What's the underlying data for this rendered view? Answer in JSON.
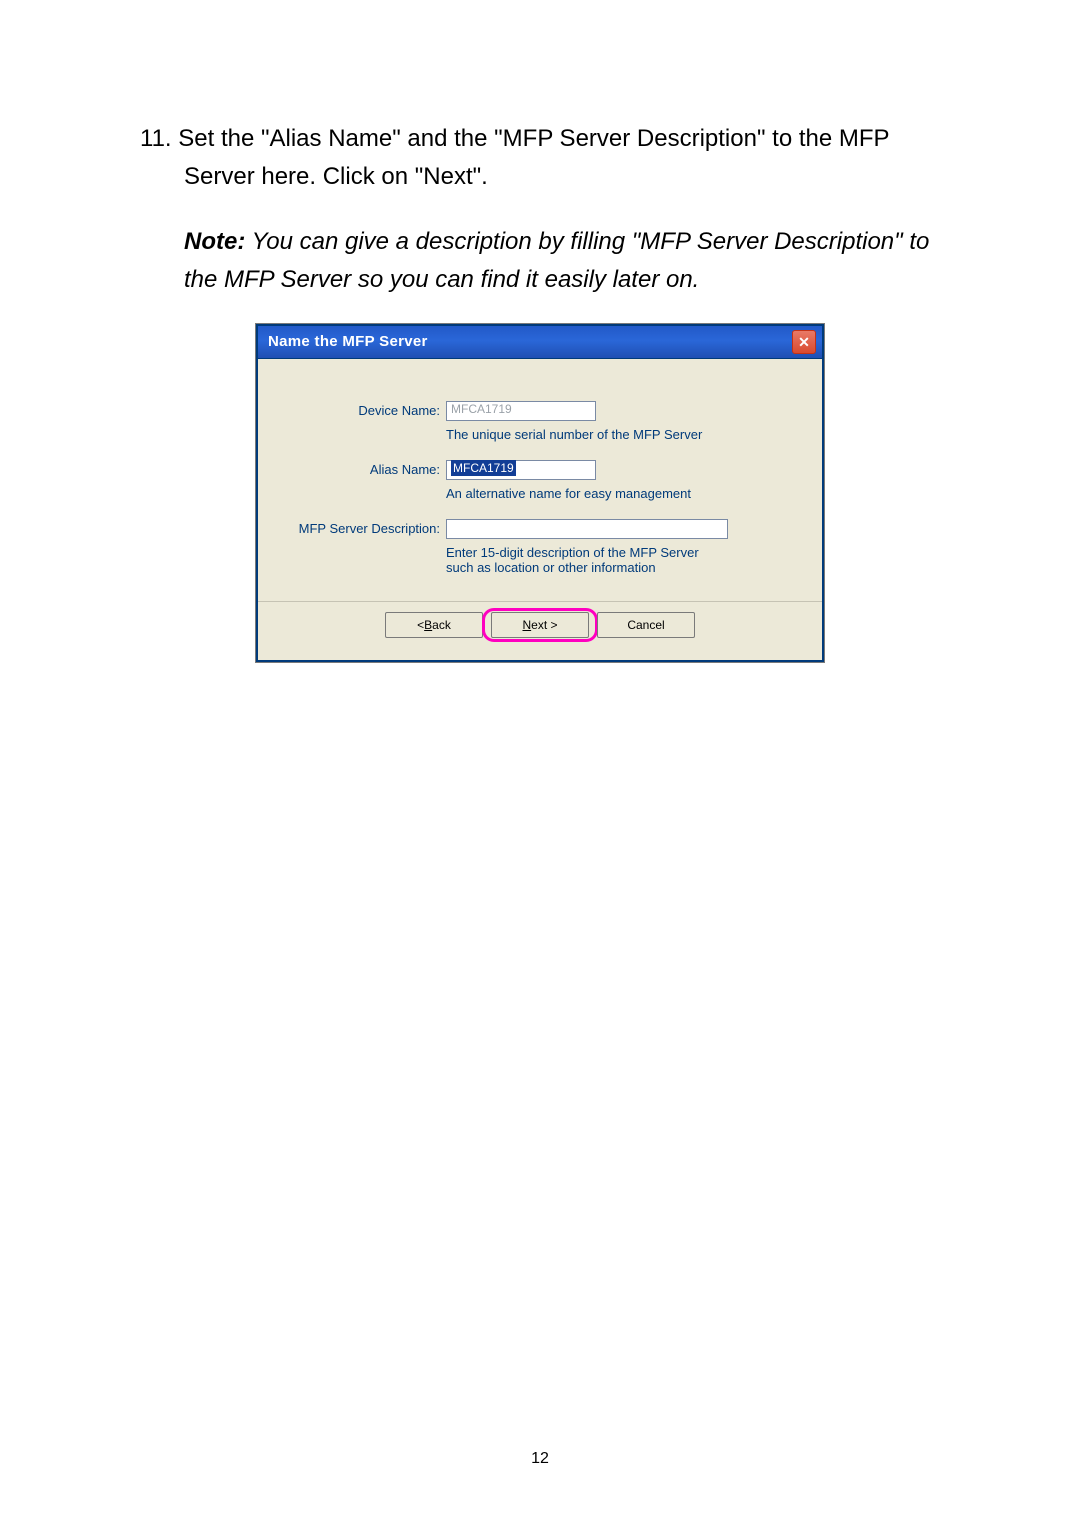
{
  "instruction": {
    "number": "11.",
    "text": "Set the \"Alias Name\" and the \"MFP Server Description\" to the MFP Server here. Click on \"Next\"."
  },
  "note": {
    "label": "Note:",
    "text": " You can give a description by filling \"MFP Server Description\" to the MFP Server so you can find it easily later on."
  },
  "dialog": {
    "title": "Name the MFP Server",
    "fields": {
      "device_name": {
        "label": "Device Name:",
        "value": "MFCA1719",
        "help": "The unique serial number of the MFP Server"
      },
      "alias_name": {
        "label": "Alias Name:",
        "value": "MFCA1719",
        "help": "An alternative name for easy management"
      },
      "description": {
        "label": "MFP Server Description:",
        "value": "",
        "help1": "Enter 15-digit description of the MFP Server",
        "help2": "such as location or other information"
      }
    },
    "buttons": {
      "back_prefix": "< ",
      "back_u": "B",
      "back_suffix": "ack",
      "next_u": "N",
      "next_suffix": "ext >",
      "cancel": "Cancel"
    }
  },
  "page_number": "12"
}
